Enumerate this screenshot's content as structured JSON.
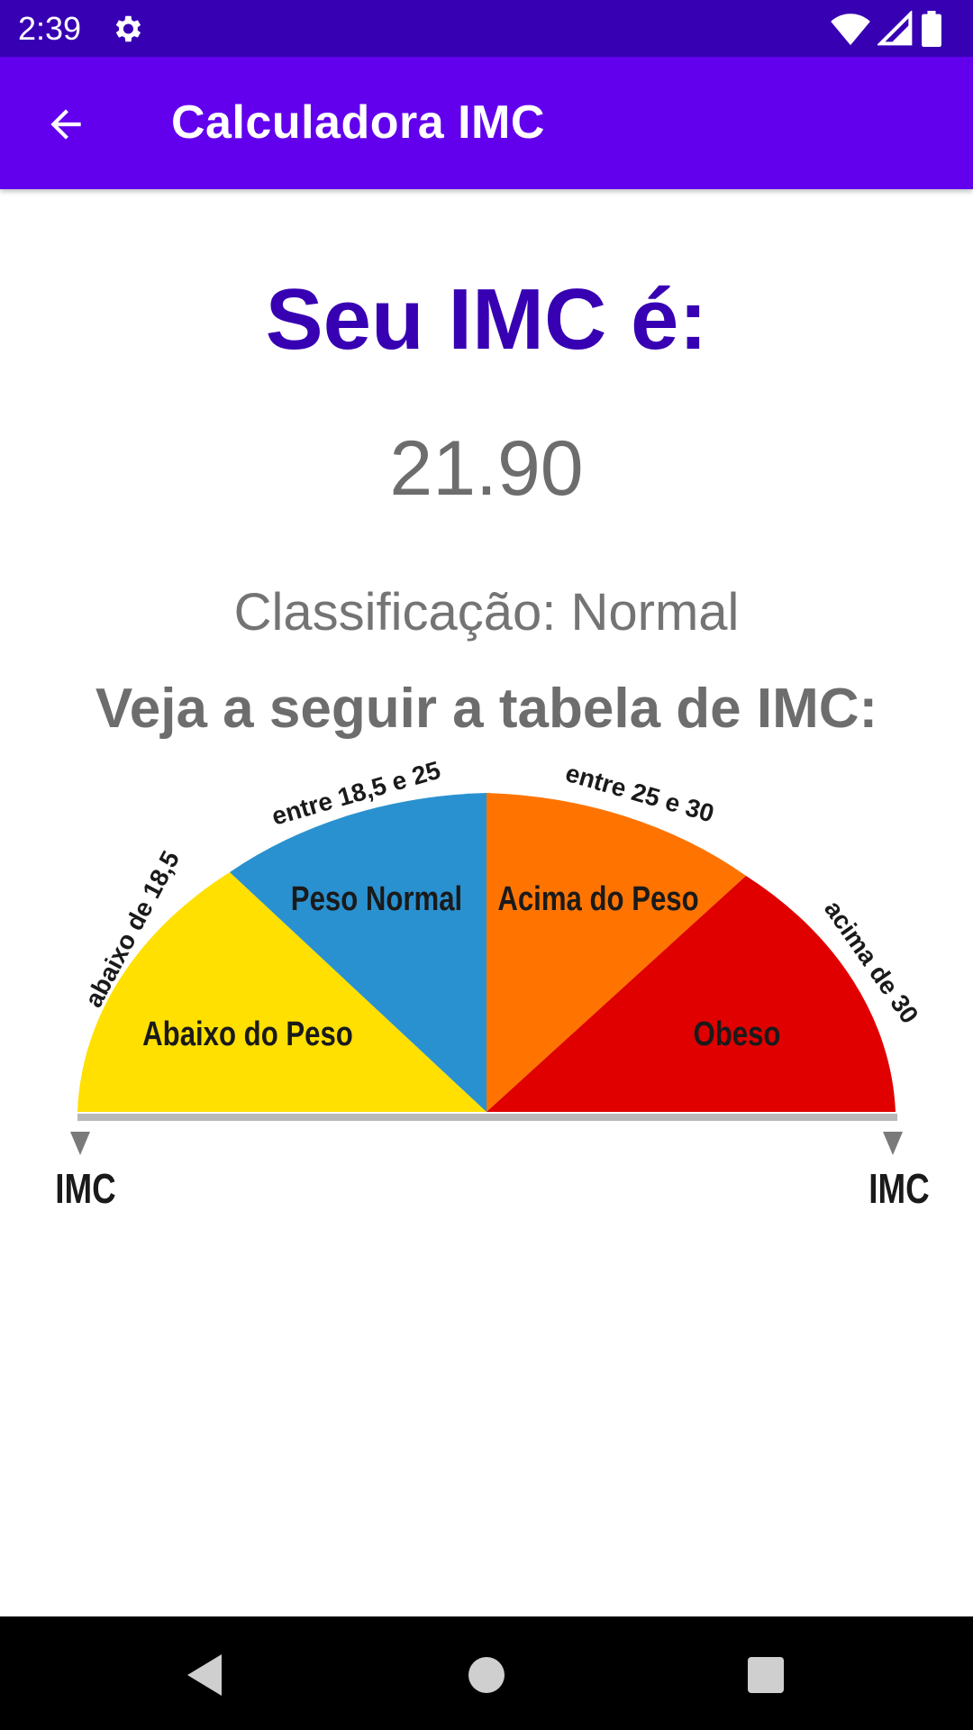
{
  "status_bar": {
    "time": "2:39",
    "icons": [
      "gear-icon",
      "wifi-icon",
      "signal-icon",
      "battery-icon"
    ],
    "background": "#3700b3"
  },
  "app_bar": {
    "title": "Calculadora IMC",
    "back_icon": "arrow-back-icon",
    "background": "#6200ee"
  },
  "result": {
    "title": "Seu IMC é:",
    "value": "21.90",
    "classification": "Classificação: Normal",
    "title_color": "#3700b3"
  },
  "table": {
    "heading": "Veja a seguir a tabela de IMC:",
    "segments": [
      {
        "name": "Abaixo do Peso",
        "range": "abaixo de 18,5",
        "color": "#ffe000"
      },
      {
        "name": "Peso Normal",
        "range": "entre 18,5 e 25",
        "color": "#2a91d0"
      },
      {
        "name": "Acima do Peso",
        "range": "entre 25 e 30",
        "color": "#ff7400"
      },
      {
        "name": "Obeso",
        "range": "acima de 30",
        "color": "#e00000"
      }
    ],
    "axis_left": "IMC",
    "axis_right": "IMC"
  },
  "nav_bar": {
    "icons": [
      "back-triangle-icon",
      "home-circle-icon",
      "recents-square-icon"
    ]
  }
}
